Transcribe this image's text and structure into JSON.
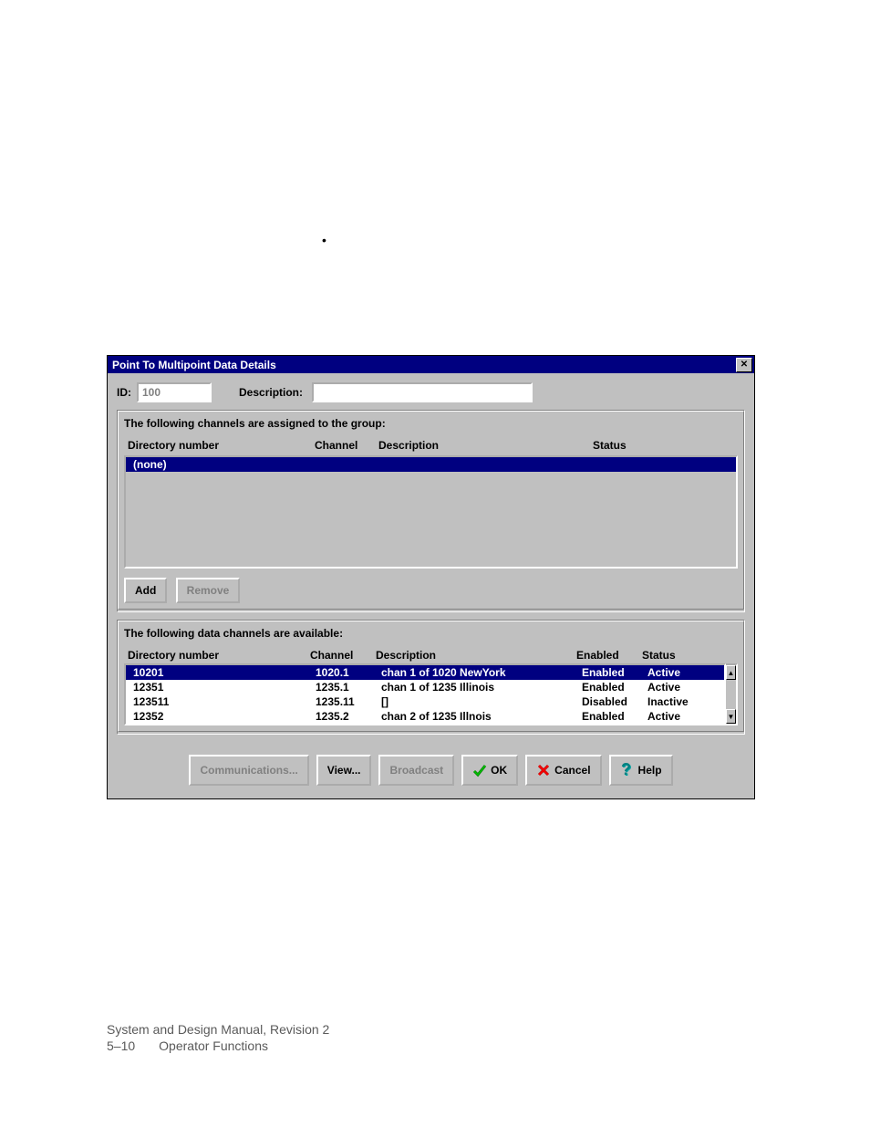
{
  "window": {
    "title": "Point To Multipoint Data Details"
  },
  "form": {
    "id_label": "ID:",
    "id_value": "100",
    "desc_label": "Description:",
    "desc_value": ""
  },
  "assigned": {
    "caption": "The following channels are assigned to the group:",
    "headers": {
      "dir": "Directory number",
      "chan": "Channel",
      "desc": "Description",
      "stat": "Status"
    },
    "rows": [
      {
        "dir": "(none)"
      }
    ]
  },
  "available": {
    "caption": "The following data channels are available:",
    "headers": {
      "dir": "Directory number",
      "chan": "Channel",
      "desc": "Description",
      "en": "Enabled",
      "stat": "Status"
    },
    "rows": [
      {
        "dir": "10201",
        "chan": "1020.1",
        "desc": "chan 1 of 1020 NewYork",
        "en": "Enabled",
        "stat": "Active"
      },
      {
        "dir": "12351",
        "chan": "1235.1",
        "desc": "chan 1 of 1235 Illinois",
        "en": "Enabled",
        "stat": "Active"
      },
      {
        "dir": "123511",
        "chan": "1235.11",
        "desc": "[]",
        "en": "Disabled",
        "stat": "Inactive"
      },
      {
        "dir": "12352",
        "chan": "1235.2",
        "desc": "chan 2 of 1235 Illnois",
        "en": "Enabled",
        "stat": "Active"
      }
    ]
  },
  "buttons": {
    "add": "Add",
    "remove": "Remove",
    "comm": "Communications...",
    "view": "View...",
    "broadcast": "Broadcast",
    "ok": "OK",
    "cancel": "Cancel",
    "help": "Help"
  },
  "footer": {
    "line1": "System and Design Manual, Revision 2",
    "page": "5–10",
    "section": "Operator Functions"
  }
}
